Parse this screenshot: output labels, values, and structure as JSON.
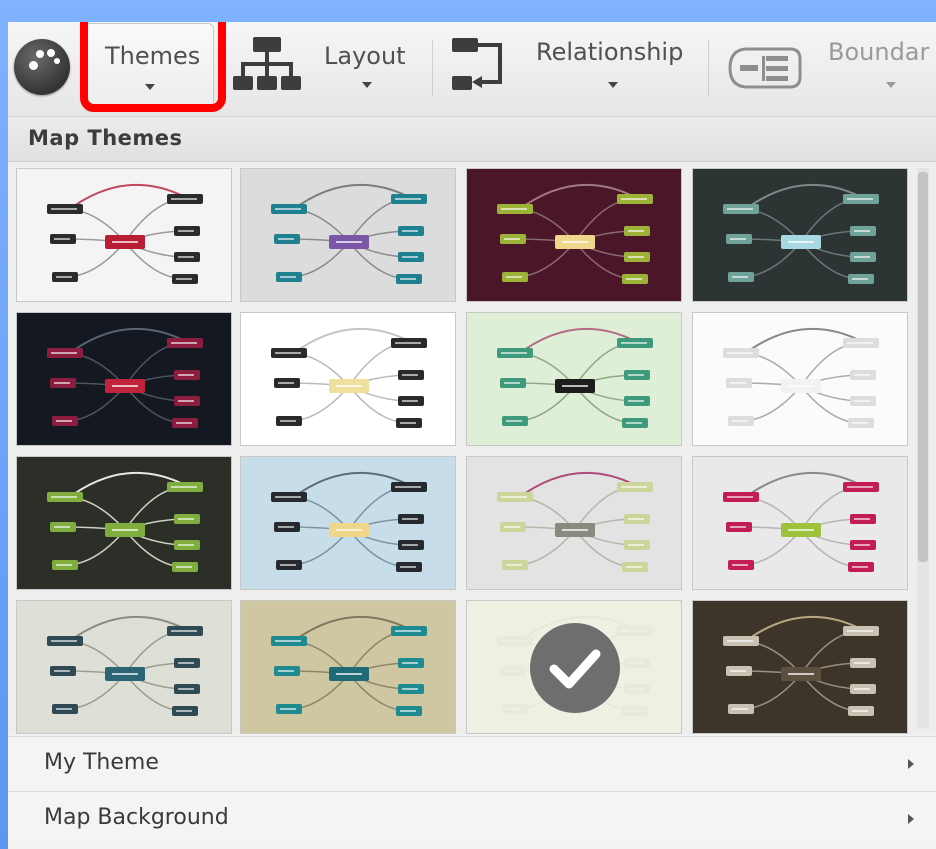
{
  "toolbar": {
    "themes_label": "Themes",
    "layout_label": "Layout",
    "relationship_label": "Relationship",
    "boundary_label": "Boundar"
  },
  "panel": {
    "title": "Map Themes",
    "themes": [
      {
        "bg": "#f4f4f4",
        "node": "#2b2b2b",
        "center": "#b81d33",
        "line": "#9a9a9a",
        "rel": "#c0465e"
      },
      {
        "bg": "#dcdcdc",
        "node": "#1f8090",
        "center": "#7b56a6",
        "line": "#8a8a8a",
        "rel": "#7b7b7b"
      },
      {
        "bg": "#4a1628",
        "node": "#9cb338",
        "center": "#f0d68a",
        "line": "#8a6a72",
        "rel": "#a07b80"
      },
      {
        "bg": "#2c3434",
        "node": "#6fa39a",
        "center": "#a8d8e0",
        "line": "#6a7878",
        "rel": "#7c8a88"
      },
      {
        "bg": "#141820",
        "node": "#8c1d3f",
        "center": "#c0243a",
        "line": "#4d5560",
        "rel": "#5b6472"
      },
      {
        "bg": "#ffffff",
        "node": "#2a2a2a",
        "center": "#efe0a0",
        "line": "#b9b9b9",
        "rel": "#c4c4c4"
      },
      {
        "bg": "#dfeed6",
        "node": "#3e9a7a",
        "center": "#1d1d1d",
        "line": "#8ca888",
        "rel": "#b56a86"
      },
      {
        "bg": "#fbfbfb",
        "node": "#dddddd",
        "center": "#f2f2f2",
        "line": "#aaaaaa",
        "rel": "#888888"
      },
      {
        "bg": "#2c2f28",
        "node": "#7fae3e",
        "center": "#7fae3e",
        "line": "#d0d0c4",
        "rel": "#e8e8e0"
      },
      {
        "bg": "#c7dde9",
        "node": "#262a2e",
        "center": "#efd68a",
        "line": "#7c93a0",
        "rel": "#5b6c78"
      },
      {
        "bg": "#e3e3e3",
        "node": "#cdd59a",
        "center": "#8a8a7e",
        "line": "#b5b5aa",
        "rel": "#b04a7a"
      },
      {
        "bg": "#e9e9e9",
        "node": "#c21e55",
        "center": "#9ec23a",
        "line": "#b4b4b4",
        "rel": "#8a8a8a"
      },
      {
        "bg": "#dedfd6",
        "node": "#2f4a55",
        "center": "#2b6575",
        "line": "#9a9c8e",
        "rel": "#8a8c80"
      },
      {
        "bg": "#cfc7a2",
        "node": "#1f8a90",
        "center": "#1e6b75",
        "line": "#8a8668",
        "rel": "#7c7860"
      },
      {
        "bg": "#eef0e2",
        "node": "#d8dacb",
        "center": "#e6e8d8",
        "line": "#d0d2c2",
        "rel": "#cfd1c0"
      },
      {
        "bg": "#3e352a",
        "node": "#c9c2b3",
        "center": "#5c5040",
        "line": "#9b9080",
        "rel": "#b8a886"
      }
    ],
    "selected_index": 14
  },
  "menu": {
    "my_theme": "My Theme",
    "map_background": "Map Background"
  }
}
